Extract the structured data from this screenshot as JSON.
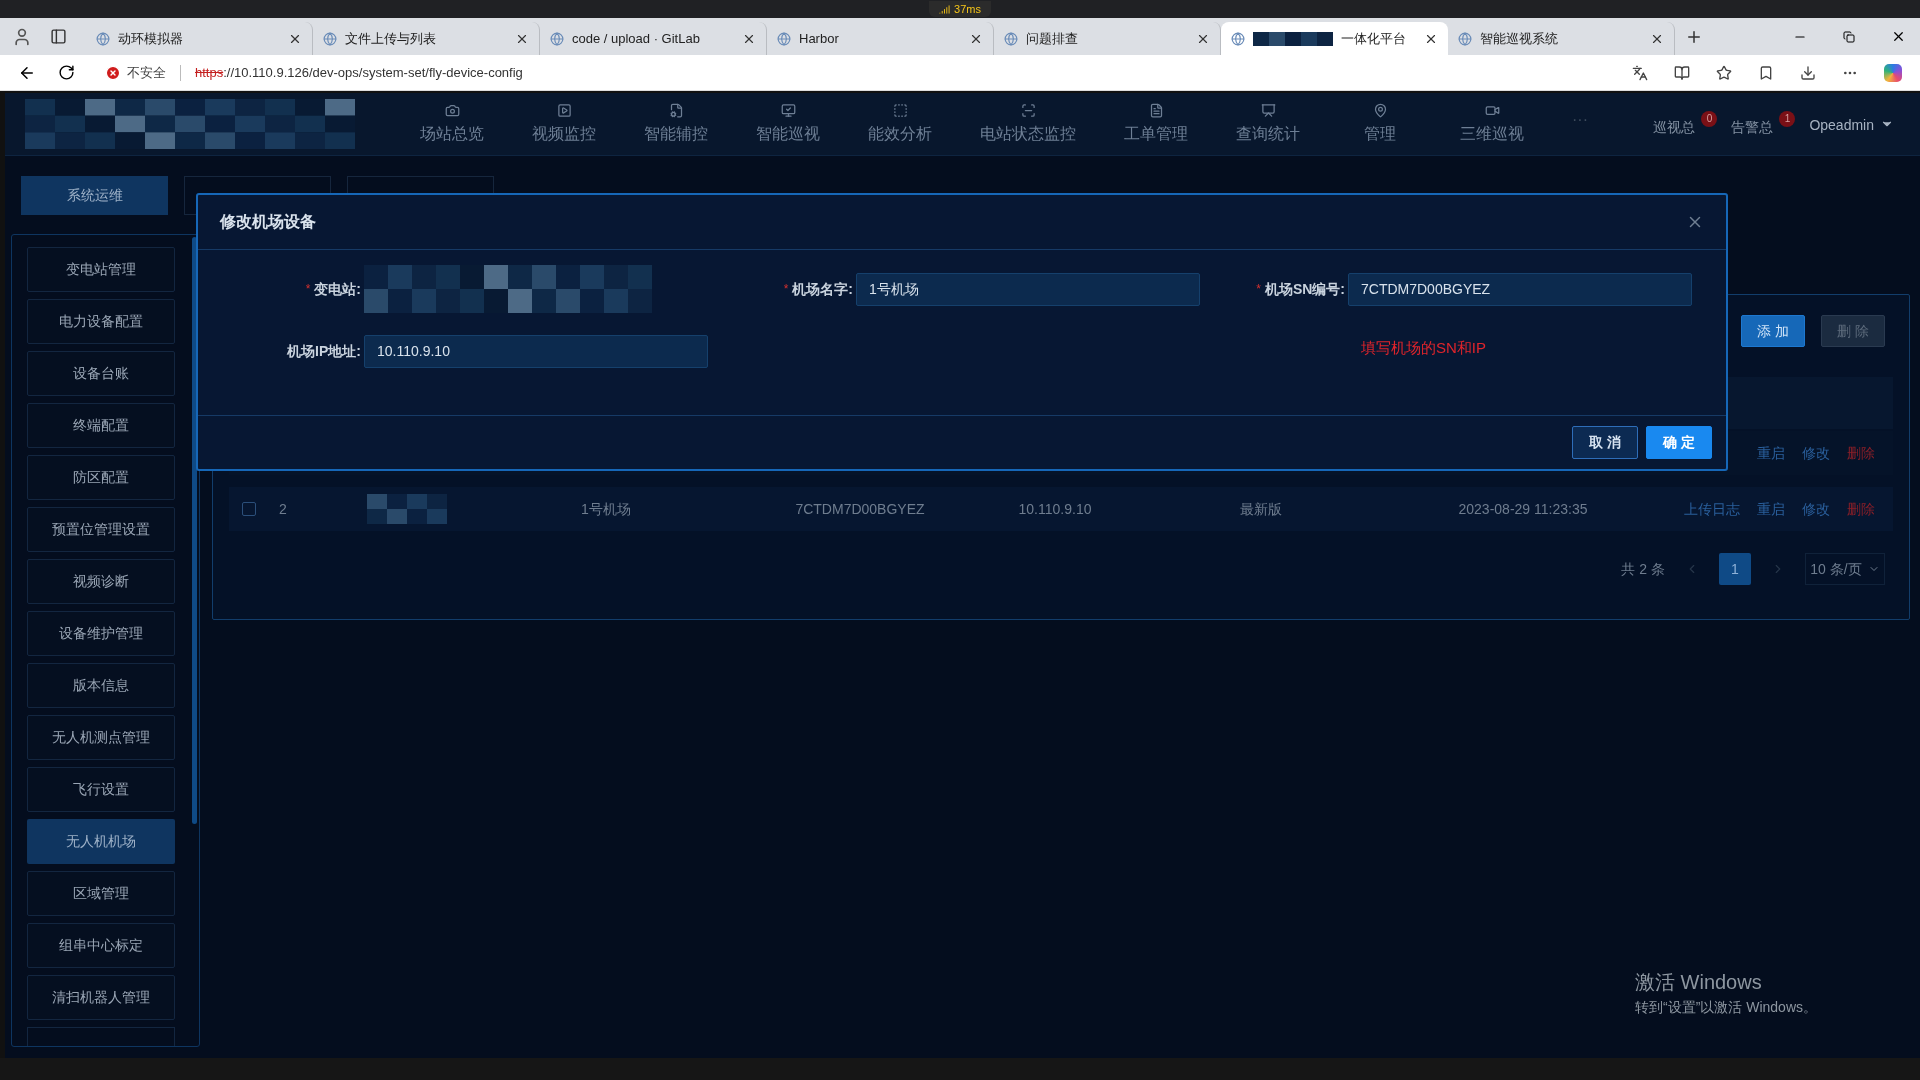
{
  "browser": {
    "network_badge": "37ms",
    "tabs": [
      {
        "title": "动环模拟器",
        "selected": false,
        "redacted": false
      },
      {
        "title": "文件上传与列表",
        "selected": false,
        "redacted": false
      },
      {
        "title": "code / upload · GitLab",
        "selected": false,
        "redacted": false
      },
      {
        "title": "Harbor",
        "selected": false,
        "redacted": false
      },
      {
        "title": "问题排查",
        "selected": false,
        "redacted": false
      },
      {
        "title": "一体化平台",
        "selected": true,
        "redacted": true
      },
      {
        "title": "智能巡视系统",
        "selected": false,
        "redacted": false
      }
    ],
    "address": {
      "security": "不安全",
      "scheme": "https",
      "rest": "://10.110.9.126/dev-ops/system-set/fly-device-config"
    }
  },
  "header": {
    "nav": [
      {
        "label": "场站总览"
      },
      {
        "label": "视频监控"
      },
      {
        "label": "智能辅控"
      },
      {
        "label": "智能巡视"
      },
      {
        "label": "能效分析"
      },
      {
        "label": "电站状态监控"
      },
      {
        "label": "工单管理"
      },
      {
        "label": "查询统计"
      },
      {
        "label": "管理"
      },
      {
        "label": "三维巡视"
      }
    ],
    "more": "···",
    "counters": [
      {
        "label": "巡视总",
        "badge": "0"
      },
      {
        "label": "告警总",
        "badge": "1"
      }
    ],
    "user": "Opeadmin"
  },
  "top_tabs": [
    {
      "label": "系统运维",
      "selected": true
    }
  ],
  "sidebar": {
    "items": [
      {
        "label": "变电站管理",
        "selected": false
      },
      {
        "label": "电力设备配置",
        "selected": false
      },
      {
        "label": "设备台账",
        "selected": false
      },
      {
        "label": "终端配置",
        "selected": false
      },
      {
        "label": "防区配置",
        "selected": false
      },
      {
        "label": "预置位管理设置",
        "selected": false
      },
      {
        "label": "视频诊断",
        "selected": false
      },
      {
        "label": "设备维护管理",
        "selected": false
      },
      {
        "label": "版本信息",
        "selected": false
      },
      {
        "label": "无人机测点管理",
        "selected": false
      },
      {
        "label": "飞行设置",
        "selected": false
      },
      {
        "label": "无人机机场",
        "selected": true
      },
      {
        "label": "区域管理",
        "selected": false
      },
      {
        "label": "组串中心标定",
        "selected": false
      },
      {
        "label": "清扫机器人管理",
        "selected": false
      }
    ]
  },
  "table": {
    "toolbar": [
      {
        "label": "添 加",
        "kind": "primary"
      },
      {
        "label": "删 除",
        "kind": "disabled"
      }
    ],
    "rows": [
      {
        "cells": [],
        "actions": [
          {
            "label": "重启",
            "kind": "link"
          },
          {
            "label": "修改",
            "kind": "link"
          },
          {
            "label": "删除",
            "kind": "danger"
          }
        ]
      },
      {
        "checked": false,
        "index": "2",
        "cells": [
          "1号机场",
          "7CTDM7D00BGYEZ",
          "10.110.9.10",
          "最新版",
          "2023-08-29 11:23:35"
        ],
        "actions": [
          {
            "label": "上传日志",
            "kind": "link"
          },
          {
            "label": "重启",
            "kind": "link"
          },
          {
            "label": "修改",
            "kind": "link"
          },
          {
            "label": "删除",
            "kind": "danger"
          }
        ]
      }
    ],
    "pagination": {
      "total": "共 2 条",
      "pages": [
        {
          "label": "1",
          "selected": true
        }
      ],
      "page_size": "10 条/页"
    }
  },
  "dialog": {
    "title": "修改机场设备",
    "fields": [
      {
        "label": "变电站:",
        "required_mark": "*",
        "redacted": true
      },
      {
        "label": "机场名字:",
        "required_mark": "*",
        "value": "1号机场"
      },
      {
        "label": "机场SN编号:",
        "required_mark": "*",
        "value": "7CTDM7D00BGYEZ"
      },
      {
        "label": "机场IP地址:",
        "value": "10.110.9.10"
      }
    ],
    "hint": "填写机场的SN和IP",
    "buttons": [
      {
        "label": "取 消",
        "kind": "secondary"
      },
      {
        "label": "确 定",
        "kind": "primary"
      }
    ]
  },
  "os_notice": {
    "title": "激活 Windows",
    "subtitle": "转到“设置”以激活 Windows。"
  }
}
